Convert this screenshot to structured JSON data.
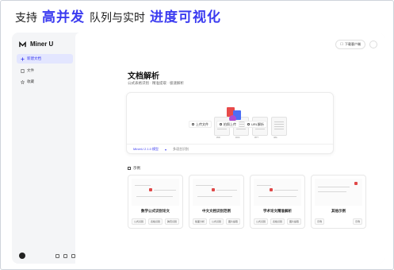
{
  "banner": {
    "part1": "支持",
    "part2": "高并发",
    "part3": "队列与实时",
    "part4": "进度可视化"
  },
  "app": {
    "name": "Miner U"
  },
  "sidebar": {
    "items": [
      {
        "label": "新建文档",
        "active": true
      },
      {
        "label": "文件",
        "active": false
      },
      {
        "label": "收藏",
        "active": false
      }
    ]
  },
  "header": {
    "download_label": "下载客户端"
  },
  "page": {
    "title": "文档解析",
    "subtitle": "公式表格识别 · 精准提取 · 极速解析"
  },
  "upload": {
    "buttons": [
      "上传文件",
      "拍照上传",
      "URL解析"
    ],
    "doc_tags": [
      "PDF",
      "DOC",
      "PPT",
      "IMG"
    ],
    "footer_model": "MinerU 2.1.0 模型",
    "footer_option": "多语言识别"
  },
  "examples": {
    "heading": "示例",
    "cards": [
      {
        "title": "数学公式识别论文",
        "tags": [
          "公式识别",
          "表格识别",
          "跨页识别"
        ]
      },
      {
        "title": "中文文档识别范例",
        "tags": [
          "版面分析",
          "公式识别",
          "图片提取"
        ]
      },
      {
        "title": "学术论文精准解析",
        "tags": [
          "公式识别",
          "表格识别",
          "图片提取"
        ]
      },
      {
        "title": "其他示例",
        "tags": [
          "示例",
          "示例"
        ]
      }
    ]
  },
  "colors": {
    "accent": "#3b3bf0",
    "active_bg": "#e3e6ff"
  }
}
